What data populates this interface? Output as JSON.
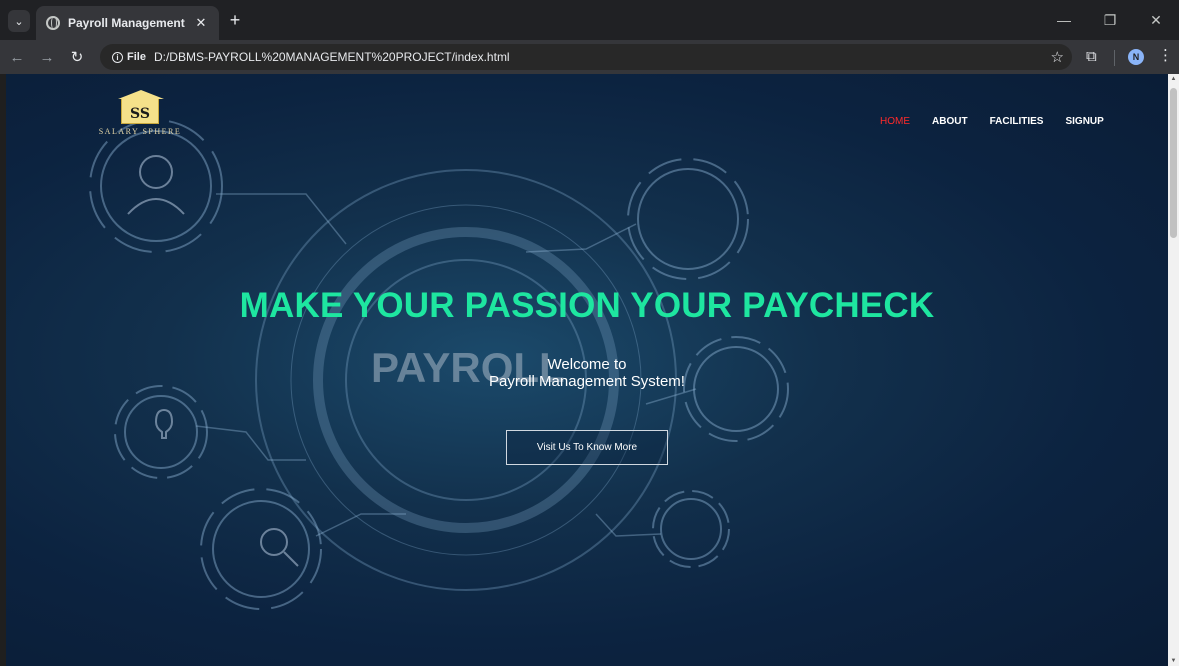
{
  "browser": {
    "tab_title": "Payroll Management",
    "url_chip": "File",
    "url": "D:/DBMS-PAYROLL%20MANAGEMENT%20PROJECT/index.html",
    "profile_initial": "N"
  },
  "site": {
    "logo_mark": "SS",
    "logo_text": "SALARY SPHERE",
    "nav": [
      "HOME",
      "ABOUT",
      "FACILITIES",
      "SIGNUP"
    ],
    "nav_active_color": "#ff2a2a",
    "background_word": "PAYROLL",
    "headline": "MAKE YOUR PASSION YOUR PAYCHECK",
    "headline_color": "#1ee6a0",
    "welcome_line1": "Welcome to",
    "welcome_line2": "Payroll Management System!",
    "cta_label": "Visit Us To Know More"
  }
}
